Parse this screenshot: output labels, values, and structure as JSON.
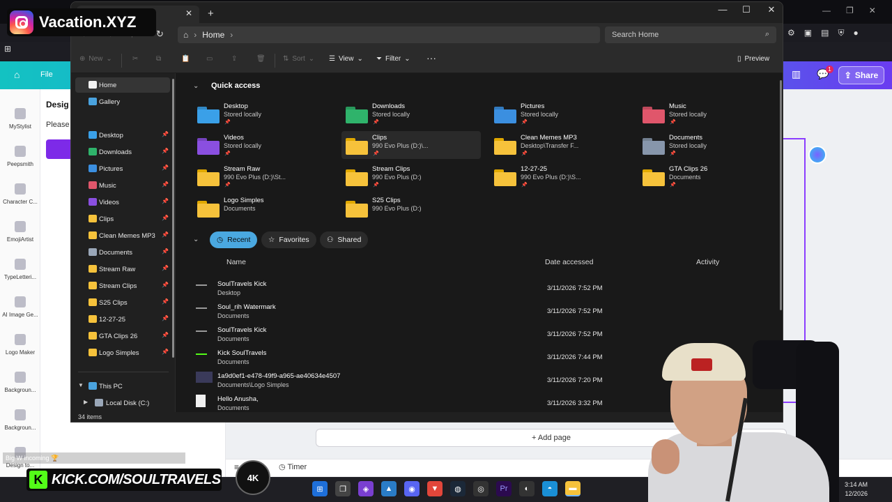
{
  "overlay": {
    "instagram_handle": "Vacation.XYZ",
    "kick_url": "KICK.COM/SOULTRAVELS",
    "badge_4k": "4K",
    "chat_message_text": "Big W incoming 🏆"
  },
  "background_app": {
    "file_label": "File",
    "design_title": "Desig",
    "please_text": "Please",
    "share_label": "Share",
    "notification_count": "1",
    "add_page_label": "+ Add page",
    "timer_label": "Timer",
    "sidebar_apps": [
      "MyStylist",
      "Peepsmith",
      "Character C...",
      "EmojiArtist",
      "TypeLetteri...",
      "AI Image Ge...",
      "Logo Maker",
      "Backgroun...",
      "Backgroun...",
      "Design to..."
    ]
  },
  "explorer": {
    "address": {
      "location": "Home",
      "search_placeholder": "Search Home"
    },
    "toolbar": {
      "new_label": "New",
      "sort_label": "Sort",
      "view_label": "View",
      "filter_label": "Filter",
      "more_label": "···",
      "preview_label": "Preview"
    },
    "nav": {
      "top": [
        {
          "label": "Home",
          "color": "#f2f2f2"
        },
        {
          "label": "Gallery",
          "color": "#4aa3df"
        }
      ],
      "pinned": [
        {
          "label": "Desktop",
          "color": "#3aa0e8"
        },
        {
          "label": "Downloads",
          "color": "#2fb36b"
        },
        {
          "label": "Pictures",
          "color": "#3b8fe0"
        },
        {
          "label": "Music",
          "color": "#e0566b"
        },
        {
          "label": "Videos",
          "color": "#8a4fe0"
        },
        {
          "label": "Clips",
          "color": "#f6c23b"
        },
        {
          "label": "Clean Memes MP3",
          "color": "#f6c23b"
        },
        {
          "label": "Documents",
          "color": "#9aa7b8"
        },
        {
          "label": "Stream Raw",
          "color": "#f6c23b"
        },
        {
          "label": "Stream Clips",
          "color": "#f6c23b"
        },
        {
          "label": "S25 Clips",
          "color": "#f6c23b"
        },
        {
          "label": "12-27-25",
          "color": "#f6c23b"
        },
        {
          "label": "GTA Clips 26",
          "color": "#f6c23b"
        },
        {
          "label": "Logo Simples",
          "color": "#f6c23b"
        }
      ],
      "this_pc": "This PC",
      "local_disk": "Local Disk (C:)"
    },
    "quick_access": {
      "title": "Quick access",
      "items": [
        {
          "name": "Desktop",
          "sub": "Stored locally",
          "icon": "desktop-folder-icon",
          "pinned": true
        },
        {
          "name": "Downloads",
          "sub": "Stored locally",
          "icon": "downloads-folder-icon",
          "pinned": true
        },
        {
          "name": "Pictures",
          "sub": "Stored locally",
          "icon": "pictures-folder-icon",
          "pinned": true
        },
        {
          "name": "Music",
          "sub": "Stored locally",
          "icon": "music-folder-icon",
          "pinned": true
        },
        {
          "name": "Videos",
          "sub": "Stored locally",
          "icon": "videos-folder-icon",
          "pinned": true
        },
        {
          "name": "Clips",
          "sub": "990 Evo Plus (D:)\\...",
          "icon": "folder-icon",
          "pinned": true
        },
        {
          "name": "Clean Memes MP3",
          "sub": "Desktop\\Transfer F...",
          "icon": "folder-icon",
          "pinned": true
        },
        {
          "name": "Documents",
          "sub": "Stored locally",
          "icon": "documents-folder-icon",
          "pinned": true
        },
        {
          "name": "Stream Raw",
          "sub": "990 Evo Plus (D:)\\St...",
          "icon": "folder-icon",
          "pinned": true
        },
        {
          "name": "Stream Clips",
          "sub": "990 Evo Plus (D:)",
          "icon": "folder-icon",
          "pinned": true
        },
        {
          "name": "12-27-25",
          "sub": "990 Evo Plus (D:)\\S...",
          "icon": "folder-icon",
          "pinned": true
        },
        {
          "name": "GTA Clips 26",
          "sub": "Documents",
          "icon": "folder-icon",
          "pinned": true
        },
        {
          "name": "Logo Simples",
          "sub": "Documents",
          "icon": "folder-icon",
          "pinned": false
        },
        {
          "name": "S25 Clips",
          "sub": "990 Evo Plus (D:)",
          "icon": "folder-icon",
          "pinned": false
        }
      ]
    },
    "recent_tabs": {
      "recent": "Recent",
      "favorites": "Favorites",
      "shared": "Shared"
    },
    "columns": {
      "name": "Name",
      "date": "Date accessed",
      "activity": "Activity"
    },
    "recent_files": [
      {
        "name": "SoulTravels Kick",
        "location": "Desktop",
        "date": "3/11/2026 7:52 PM"
      },
      {
        "name": "Soul_rih Watermark",
        "location": "Documents",
        "date": "3/11/2026 7:52 PM"
      },
      {
        "name": "SoulTravels Kick",
        "location": "Documents",
        "date": "3/11/2026 7:52 PM"
      },
      {
        "name": "Kick SoulTravels",
        "location": "Documents",
        "date": "3/11/2026 7:44 PM"
      },
      {
        "name": "1a9d0ef1-e478-49f9-a965-ae40634e4507",
        "location": "Documents\\Logo Simples",
        "date": "3/11/2026 7:20 PM"
      },
      {
        "name": "Hello Anusha,",
        "location": "Documents",
        "date": "3/11/2026 3:32 PM"
      }
    ],
    "status": "34 items"
  },
  "taskbar": {
    "time": "3:14 AM",
    "date": "12/2026"
  }
}
